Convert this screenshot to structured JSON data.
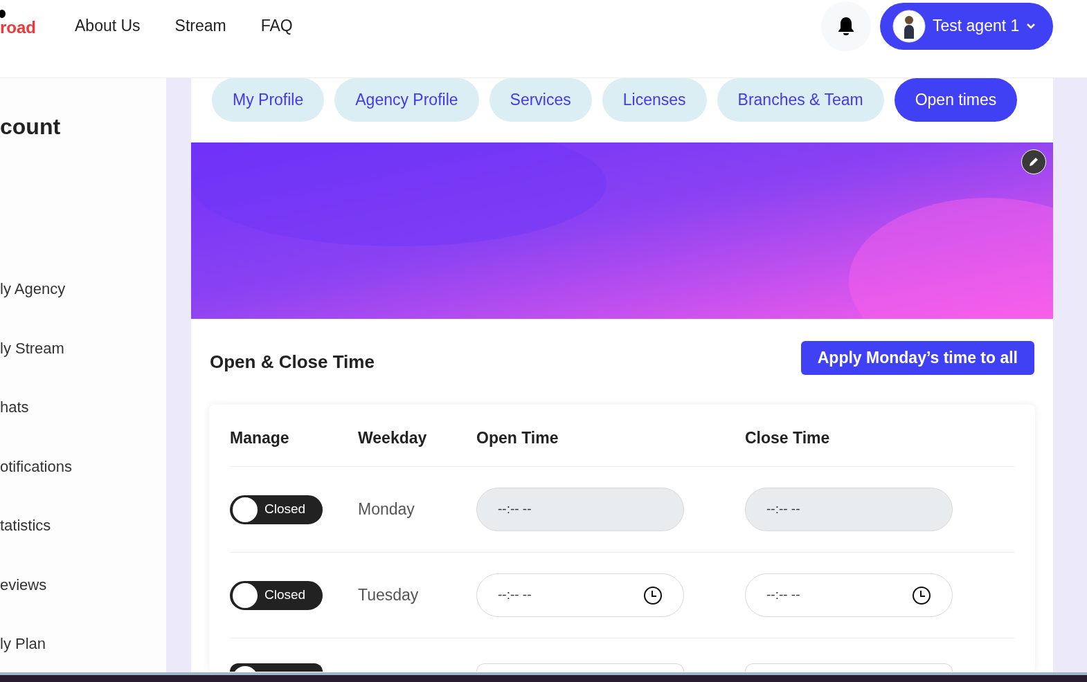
{
  "header": {
    "logo": "road",
    "nav": [
      "About Us",
      "Stream",
      "FAQ"
    ],
    "user": {
      "name": "Test agent 1"
    }
  },
  "sidebar": {
    "title": "count",
    "items": [
      "ly Agency",
      "ly Stream",
      "hats",
      "otifications",
      "tatistics",
      "eviews",
      "ly Plan"
    ]
  },
  "tabs": [
    {
      "label": "My Profile",
      "selected": false
    },
    {
      "label": "Agency Profile",
      "selected": false
    },
    {
      "label": "Services",
      "selected": false
    },
    {
      "label": "Licenses",
      "selected": false
    },
    {
      "label": "Branches & Team",
      "selected": false
    },
    {
      "label": "Open times",
      "selected": true
    }
  ],
  "section": {
    "title": "Open & Close Time",
    "apply_button": "Apply Monday’s time to all"
  },
  "table": {
    "columns": [
      "Manage",
      "Weekday",
      "Open Time",
      "Close Time"
    ],
    "rows": [
      {
        "toggle": {
          "label": "Closed",
          "on": false
        },
        "weekday": "Monday",
        "open": {
          "value": "--:-- --",
          "disabled": true
        },
        "close": {
          "value": "--:-- --",
          "disabled": true
        }
      },
      {
        "toggle": {
          "label": "Closed",
          "on": false
        },
        "weekday": "Tuesday",
        "open": {
          "value": "--:-- --",
          "disabled": false
        },
        "close": {
          "value": "--:-- --",
          "disabled": false
        }
      }
    ],
    "cut_row": {
      "on": false
    }
  }
}
